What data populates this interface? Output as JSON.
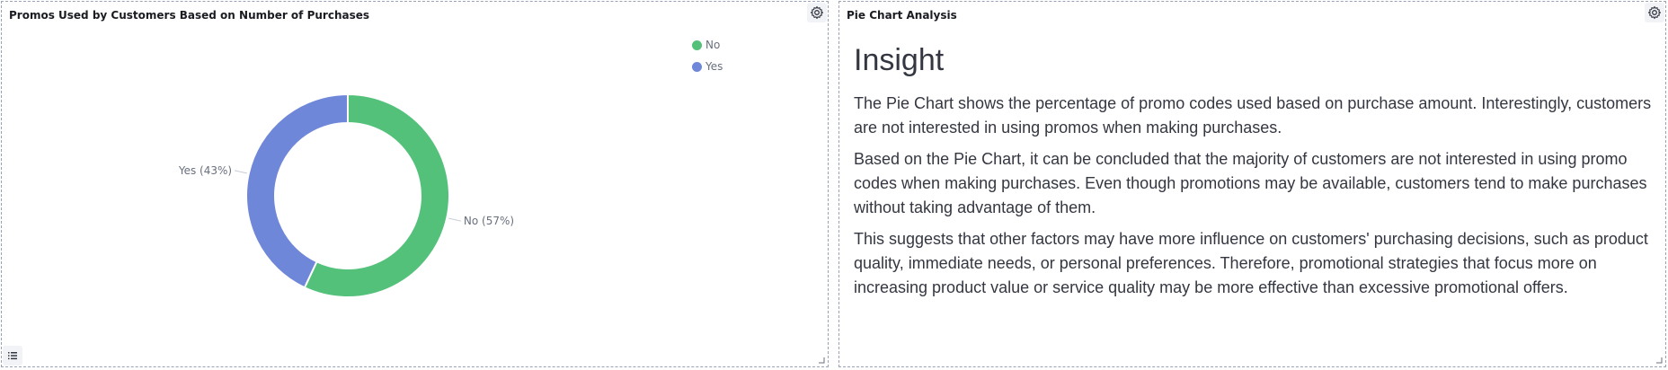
{
  "left_panel": {
    "title": "Promos Used by Customers Based on Number of Purchases"
  },
  "right_panel": {
    "title": "Pie Chart Analysis",
    "heading": "Insight",
    "paragraphs": [
      "The Pie Chart shows the percentage of promo codes used based on purchase amount. Interestingly, customers are not interested in using promos when making purchases.",
      "Based on the Pie Chart, it can be concluded that the majority of customers are not interested in using promo codes when making purchases. Even though promotions may be available, customers tend to make purchases without taking advantage of them.",
      "This suggests that other factors may have more influence on customers' purchasing decisions, such as product quality, immediate needs, or personal preferences. Therefore, promotional strategies that focus more on increasing product value or service quality may be more effective than excessive promotional offers."
    ]
  },
  "icons": {
    "gear": "gear-icon",
    "legend_toggle": "list-icon",
    "resize": "resize-handle-icon"
  },
  "chart_data": {
    "type": "pie",
    "donut": true,
    "categories": [
      "No",
      "Yes"
    ],
    "values": [
      57,
      43
    ],
    "colors": [
      "#54c17b",
      "#6f87d8"
    ],
    "slice_labels": [
      "No (57%)",
      "Yes (43%)"
    ],
    "legend": [
      {
        "label": "No",
        "color": "#54c17b"
      },
      {
        "label": "Yes",
        "color": "#6f87d8"
      }
    ],
    "legend_position": "top-right"
  }
}
